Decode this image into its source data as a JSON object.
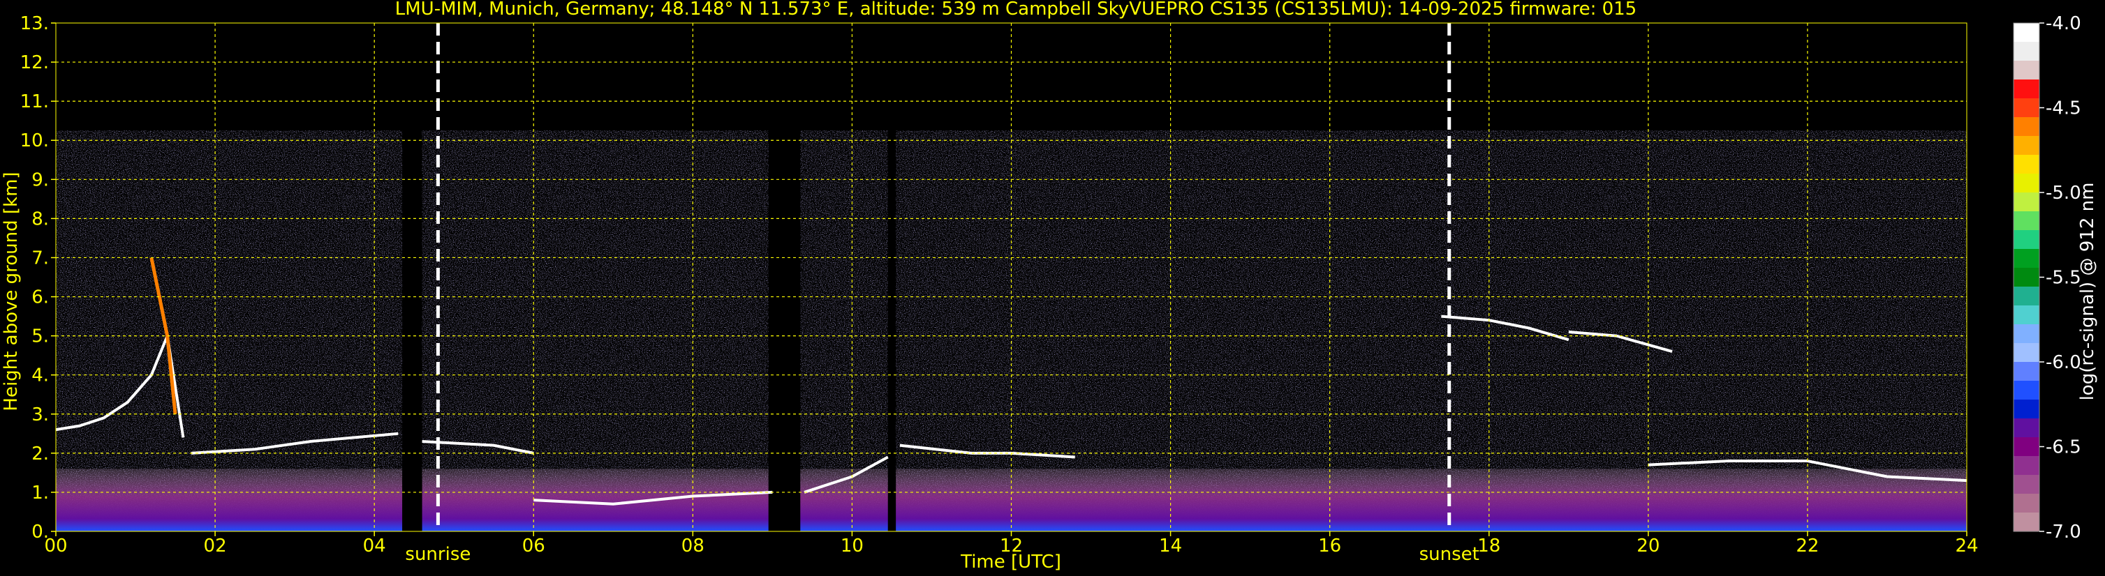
{
  "chart_data": {
    "type": "heatmap",
    "title": "LMU-MIM, Munich, Germany; 48.148° N 11.573° E, altitude: 539 m    Campbell SkyVUEPRO CS135 (CS135LMU): 14-09-2025    firmware: 015",
    "xlabel": "Time [UTC]",
    "ylabel": "Height above ground [km]",
    "xlim": [
      0,
      24
    ],
    "ylim": [
      0,
      13
    ],
    "x_ticks": [
      "00",
      "02",
      "04",
      "06",
      "08",
      "10",
      "12",
      "14",
      "16",
      "18",
      "20",
      "22",
      "24"
    ],
    "y_ticks": [
      "0.",
      "1.",
      "2.",
      "3.",
      "4.",
      "5.",
      "6.",
      "7.",
      "8.",
      "9.",
      "10.",
      "11.",
      "12.",
      "13."
    ],
    "grid": true,
    "grid_color": "#ffff00",
    "text_color": "#ffff00",
    "markers": [
      {
        "label": "sunrise",
        "time": 4.8
      },
      {
        "label": "sunset",
        "time": 17.5
      }
    ],
    "colorbar": {
      "label": "log(rc-signal) @ 912 nm",
      "range": [
        -7.0,
        -4.0
      ],
      "ticks": [
        "-4.0",
        "-4.5",
        "-5.0",
        "-5.5",
        "-6.0",
        "-6.5",
        "-7.0"
      ],
      "colors": [
        "#ffffff",
        "#eeeeee",
        "#e0c8c8",
        "#ff1010",
        "#ff4010",
        "#ff8000",
        "#ffb000",
        "#ffe000",
        "#e8f000",
        "#c0f040",
        "#60e060",
        "#20d080",
        "#00a020",
        "#008a10",
        "#20b090",
        "#50d0d0",
        "#80b0ff",
        "#a0c0ff",
        "#6080ff",
        "#2050ff",
        "#0020d0",
        "#6010a0",
        "#800080",
        "#903090",
        "#a05090",
        "#b07090",
        "#c090a0"
      ]
    },
    "missing_data_gaps": [
      [
        4.35,
        4.6
      ],
      [
        8.95,
        9.35
      ],
      [
        10.45,
        10.55
      ]
    ],
    "signal_top_km": 10.25,
    "cloud_layers": [
      {
        "t": [
          0.0,
          0.3,
          0.6,
          0.9,
          1.2,
          1.4,
          1.6
        ],
        "h": [
          2.6,
          2.7,
          2.9,
          3.3,
          4.0,
          5.0,
          2.4
        ]
      },
      {
        "t": [
          1.7,
          2.5,
          3.2,
          4.3
        ],
        "h": [
          2.0,
          2.1,
          2.3,
          2.5
        ]
      },
      {
        "t": [
          4.6,
          5.5,
          6.0
        ],
        "h": [
          2.3,
          2.2,
          2.0
        ]
      },
      {
        "t": [
          6.0,
          7.0,
          8.0,
          9.0
        ],
        "h": [
          0.8,
          0.7,
          0.9,
          1.0
        ]
      },
      {
        "t": [
          9.4,
          10.0,
          10.45
        ],
        "h": [
          1.0,
          1.4,
          1.9
        ]
      },
      {
        "t": [
          10.6,
          11.5,
          12.0,
          12.8
        ],
        "h": [
          2.2,
          2.0,
          2.0,
          1.9
        ]
      },
      {
        "t": [
          17.4,
          18.0,
          18.5,
          19.0
        ],
        "h": [
          5.5,
          5.4,
          5.2,
          4.9
        ]
      },
      {
        "t": [
          19.0,
          19.6,
          20.3
        ],
        "h": [
          5.1,
          5.0,
          4.6
        ]
      },
      {
        "t": [
          20.0,
          21.0,
          22.0,
          23.0,
          24.0
        ],
        "h": [
          1.7,
          1.8,
          1.8,
          1.4,
          1.3
        ]
      }
    ],
    "plume": {
      "t": [
        1.2,
        1.3,
        1.4,
        1.5
      ],
      "h": [
        7.0,
        6.0,
        5.0,
        3.0
      ]
    }
  }
}
